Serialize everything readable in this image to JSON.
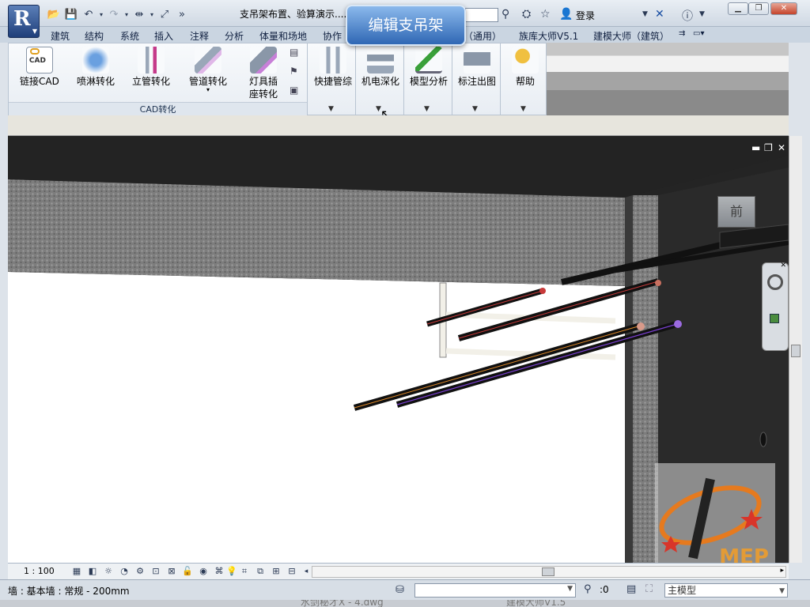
{
  "titlebar": {
    "doc_title": "支吊架布置、验算演示....",
    "login_label": "登录",
    "overlay_title": "编辑支吊架"
  },
  "tabs": [
    "建筑",
    "结构",
    "系统",
    "插入",
    "注释",
    "分析",
    "体量和场地",
    "协作",
    "（通用）",
    "族库大师V5.1",
    "建模大师（建筑）"
  ],
  "ribbon": {
    "cad_buttons": [
      "链接CAD",
      "喷淋转化",
      "立管转化",
      "管道转化",
      "灯具插座转化"
    ],
    "cad_panel_title": "CAD转化",
    "cad_icon_text": "CAD",
    "tool_buttons": [
      "快捷管综",
      "机电深化",
      "模型分析",
      "标注出图",
      "帮助"
    ]
  },
  "viewport": {
    "viewcube_label": "前",
    "logo_text": "MEP"
  },
  "viewbar": {
    "scale": "1 : 100"
  },
  "statusbar": {
    "status_text": "墙 : 基本墙 : 常规 - 200mm",
    "zero_label": ":0",
    "model_label": "主模型"
  },
  "taskbar": {
    "fragment_a": "水剑秘才X - 4.dwg",
    "fragment_b": "建模大师V1.5"
  },
  "colors": {
    "ribbon_bg": "#e8edf3",
    "viewport_bg": "#242424",
    "tooltip_blue": "#2f67b4",
    "pipe_red": "#c83a3a",
    "pipe_purple": "#7a3fd1",
    "pipe_orange": "#e08a2a"
  }
}
